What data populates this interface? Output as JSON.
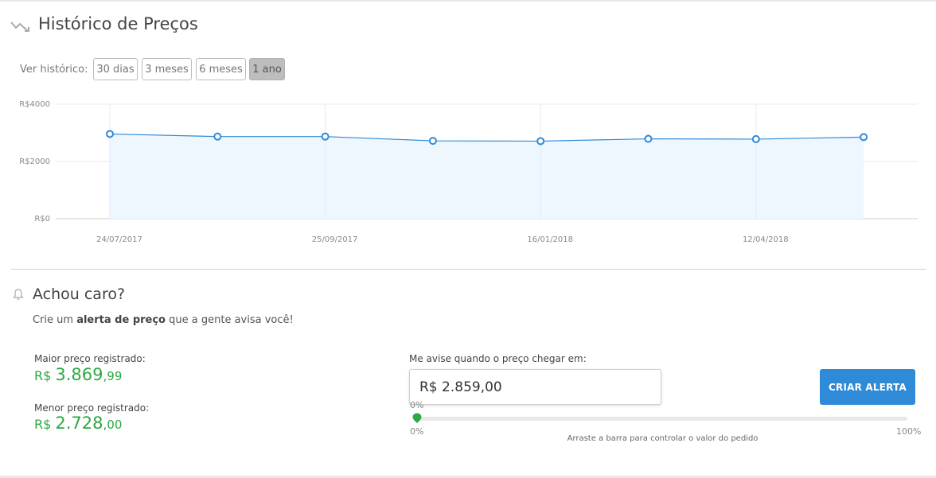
{
  "history": {
    "title": "Histórico de Preços",
    "ver_label": "Ver histórico:",
    "periods": [
      "30 dias",
      "3 meses",
      "6 meses",
      "1 ano"
    ],
    "active_period": "1 ano"
  },
  "chart_data": {
    "type": "area",
    "title": "",
    "xlabel": "",
    "ylabel": "",
    "ylim": [
      0,
      4000
    ],
    "y_ticks": [
      "R$0",
      "R$2000",
      "R$4000"
    ],
    "x_tick_labels": [
      "24/07/2017",
      "25/09/2017",
      "16/01/2018",
      "12/04/2018"
    ],
    "x": [
      "24/07/2017",
      "",
      "25/09/2017",
      "",
      "16/01/2018",
      "",
      "12/04/2018",
      ""
    ],
    "series": [
      {
        "values": [
          2960,
          2870,
          2870,
          2720,
          2710,
          2790,
          2780,
          2850
        ]
      }
    ],
    "grid": true,
    "colors": {
      "line": "#2f8ad8",
      "fill": "#eef6fe",
      "grid": "#ebebeb"
    }
  },
  "alert": {
    "title": "Achou caro?",
    "subtitle_pre": "Crie um ",
    "subtitle_bold": "alerta de preço",
    "subtitle_post": " que a gente avisa você!",
    "max_label": "Maior preço registrado:",
    "max_currency": "R$",
    "max_int": "3.869",
    "max_cents": ",99",
    "min_label": "Menor preço registrado:",
    "min_currency": "R$",
    "min_int": "2.728",
    "min_cents": ",00",
    "target_label": "Me avise quando o preço chegar em:",
    "target_value": "R$ 2.859,00",
    "button": "CRIAR ALERTA",
    "slider_value_label": "0%",
    "slider_min": "0%",
    "slider_max": "100%",
    "slider_percent": 0,
    "slider_hint": "Arraste a barra para controlar o valor do pedido",
    "accent_color": "#2ea843",
    "button_color": "#2f8ad8"
  }
}
